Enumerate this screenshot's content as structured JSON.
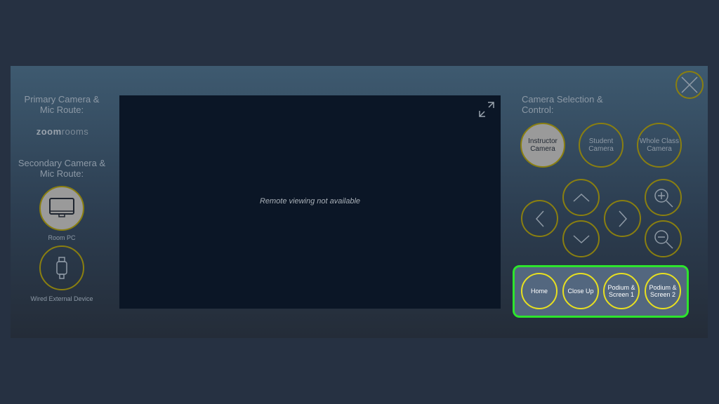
{
  "left": {
    "primary_label": "Primary Camera & Mic Route:",
    "logo": "zoomrooms",
    "secondary_label": "Secondary Camera & Mic Route:",
    "sources": [
      {
        "label": "Room PC",
        "icon": "monitor-icon",
        "selected": true
      },
      {
        "label": "Wired External Device",
        "icon": "hdmi-cable-icon",
        "selected": false
      }
    ]
  },
  "video": {
    "message": "Remote viewing not available"
  },
  "right": {
    "title": "Camera Selection & Control:",
    "cameras": [
      {
        "label": "Instructor Camera",
        "selected": true
      },
      {
        "label": "Student Camera",
        "selected": false
      },
      {
        "label": "Whole Class Camera",
        "selected": false
      }
    ],
    "presets": [
      "Home",
      "Close Up",
      "Podium & Screen 1",
      "Podium & Screen 2"
    ]
  },
  "colors": {
    "accent_ring": "#8a7f10",
    "preset_ring": "#e8e020",
    "preset_border": "#2de52d",
    "selected_fill": "#9a9a9a"
  }
}
